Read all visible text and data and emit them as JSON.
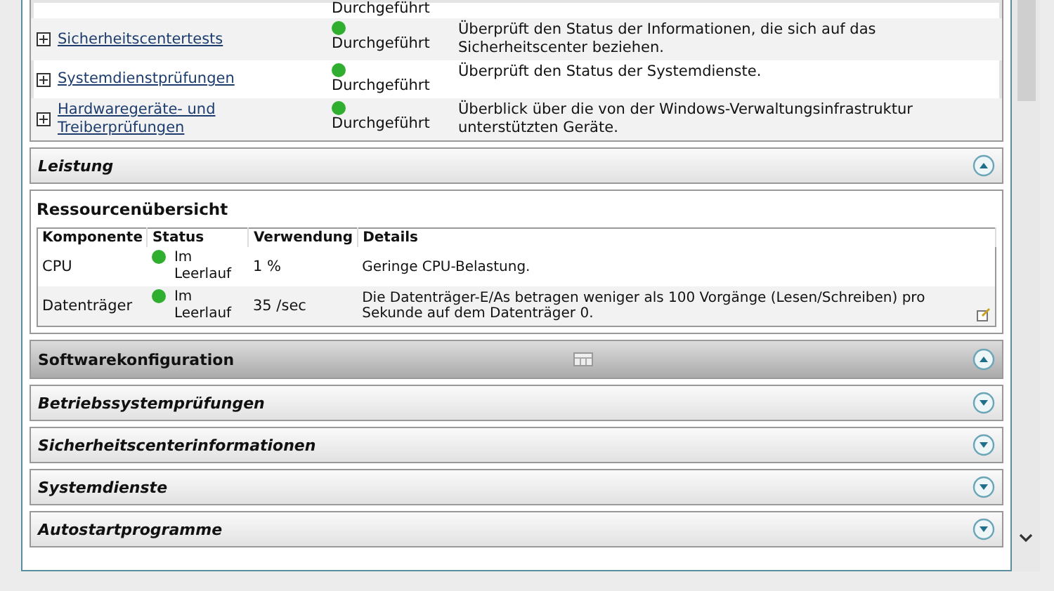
{
  "tests": [
    {
      "status": "Durchgeführt"
    },
    {
      "name": "Sicherheitscentertests",
      "status": "Durchgeführt",
      "color": "#2fae2f",
      "description": "Überprüft den Status der Informationen, die sich auf das Sicherheitscenter beziehen."
    },
    {
      "name": "Systemdienstprüfungen",
      "status": "Durchgeführt",
      "color": "#2fae2f",
      "description": "Überprüft den Status der Systemdienste."
    },
    {
      "name": "Hardwaregeräte- und Treiberprüfungen",
      "status": "Durchgeführt",
      "color": "#2fae2f",
      "description": "Überblick über die von der Windows-Verwaltungsinfrastruktur unterstützten Geräte."
    }
  ],
  "sections": [
    {
      "title": "Leistung",
      "expanded": true,
      "highlighted": false,
      "content": {
        "title": "Ressourcenübersicht",
        "columns": [
          "Komponente",
          "Status",
          "Verwendung",
          "Details"
        ],
        "rows": [
          {
            "component": "CPU",
            "status": "Im Leerlauf",
            "color": "#2fae2f",
            "usage": "1 %",
            "details": "Geringe CPU-Belastung."
          },
          {
            "component": "Datenträger",
            "status": "Im Leerlauf",
            "color": "#2fae2f",
            "usage": "35 /sec",
            "details": "Die Datenträger-E/As betragen weniger als 100 Vorgänge (Lesen/Schreiben) pro Sekunde auf dem Datenträger 0.",
            "note_icon": true
          }
        ]
      }
    },
    {
      "title": "Softwarekonfiguration",
      "expanded": true,
      "highlighted": true
    },
    {
      "title": "Betriebssystemprüfungen",
      "expanded": false,
      "highlighted": false
    },
    {
      "title": "Sicherheitscenterinformationen",
      "expanded": false,
      "highlighted": false
    },
    {
      "title": "Systemdienste",
      "expanded": false,
      "highlighted": false
    },
    {
      "title": "Autostartprogramme",
      "expanded": false,
      "highlighted": false
    }
  ]
}
